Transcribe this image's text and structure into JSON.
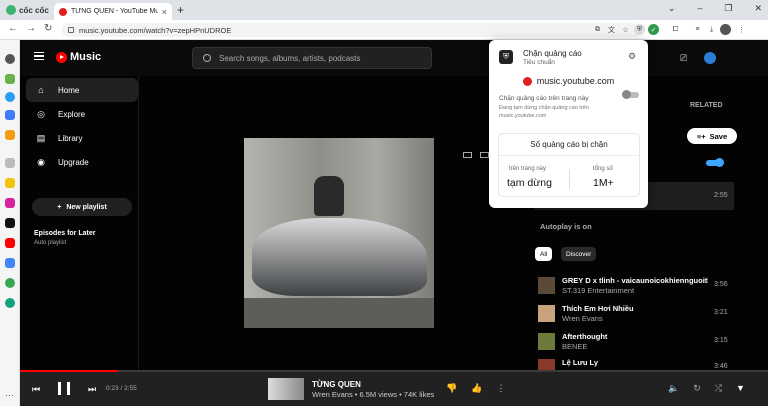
{
  "browser": {
    "brand": "cốc cốc",
    "tab_title": "TỪNG QUEN - YouTube Mu",
    "tab_close": "×",
    "new_tab": "+",
    "url": "music.youtube.com/watch?v=zepHPnUDROE",
    "window_controls": [
      "⌄",
      "–",
      "❐",
      "✕"
    ]
  },
  "ytm": {
    "logo_text": "Music",
    "search_placeholder": "Search songs, albums, artists, podcasts",
    "nav": [
      {
        "label": "Home",
        "icon": "home-icon",
        "glyph": "⌂"
      },
      {
        "label": "Explore",
        "icon": "compass-icon",
        "glyph": "◎"
      },
      {
        "label": "Library",
        "icon": "library-icon",
        "glyph": "▤"
      },
      {
        "label": "Upgrade",
        "icon": "upgrade-icon",
        "glyph": "◉"
      }
    ],
    "new_playlist": "New playlist",
    "playlist": {
      "title": "Episodes for Later",
      "subtitle": "Auto playlist"
    },
    "related_tab": "RELATED",
    "save_label": "Save",
    "current_duration": "2:55",
    "autoplay_label": "Autoplay is on",
    "chips": [
      "All",
      "Discover"
    ],
    "queue": [
      {
        "title": "GREY D x tlinh - vaicaunoicokhiennguoithaydoi",
        "artist": "ST.319 Entertainment",
        "duration": "3:56"
      },
      {
        "title": "Thích Em Hơi Nhiều",
        "artist": "Wren Evans",
        "duration": "3:21"
      },
      {
        "title": "Afterthought",
        "artist": "BENEE",
        "duration": "3:15"
      },
      {
        "title": "Lệ Lưu Ly",
        "artist": "",
        "duration": "3:46"
      }
    ],
    "player": {
      "time": "0:23 / 2:55",
      "progress": 0.131,
      "title": "TỪNG QUEN",
      "meta": "Wren Evans • 6.5M views • 74K likes"
    }
  },
  "adblock": {
    "title": "Chặn quảng cáo",
    "subtitle": "Tiêu chuẩn",
    "site": "music.youtube.com",
    "toggle_label": "Chặn quảng cáo trên trang này",
    "toggle_desc": "Đang tạm dừng chặn quảng cáo trên music.youtube.com",
    "card_title": "Số quảng cáo bị chặn",
    "col1_label": "trên trang này",
    "col1_value": "tạm dừng",
    "col2_label": "tổng số",
    "col2_value": "1M+"
  },
  "colors": {
    "accent": "#ff0000",
    "toggle_on": "#3ea6ff"
  }
}
